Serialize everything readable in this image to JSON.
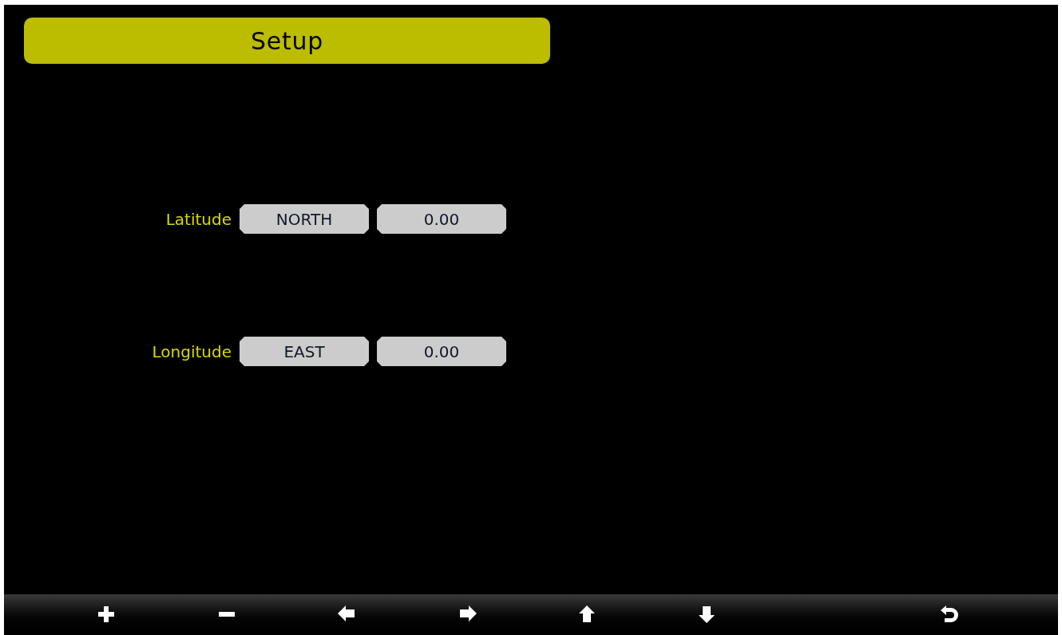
{
  "header": {
    "title": "Setup"
  },
  "rows": [
    {
      "label": "Latitude",
      "direction": "NORTH",
      "value": "0.00"
    },
    {
      "label": "Longitude",
      "direction": "EAST",
      "value": "0.00"
    }
  ],
  "toolbar": [
    {
      "kind": "plus"
    },
    {
      "kind": "minus"
    },
    {
      "kind": "left"
    },
    {
      "kind": "right"
    },
    {
      "kind": "up"
    },
    {
      "kind": "down"
    },
    {
      "kind": "back"
    }
  ]
}
